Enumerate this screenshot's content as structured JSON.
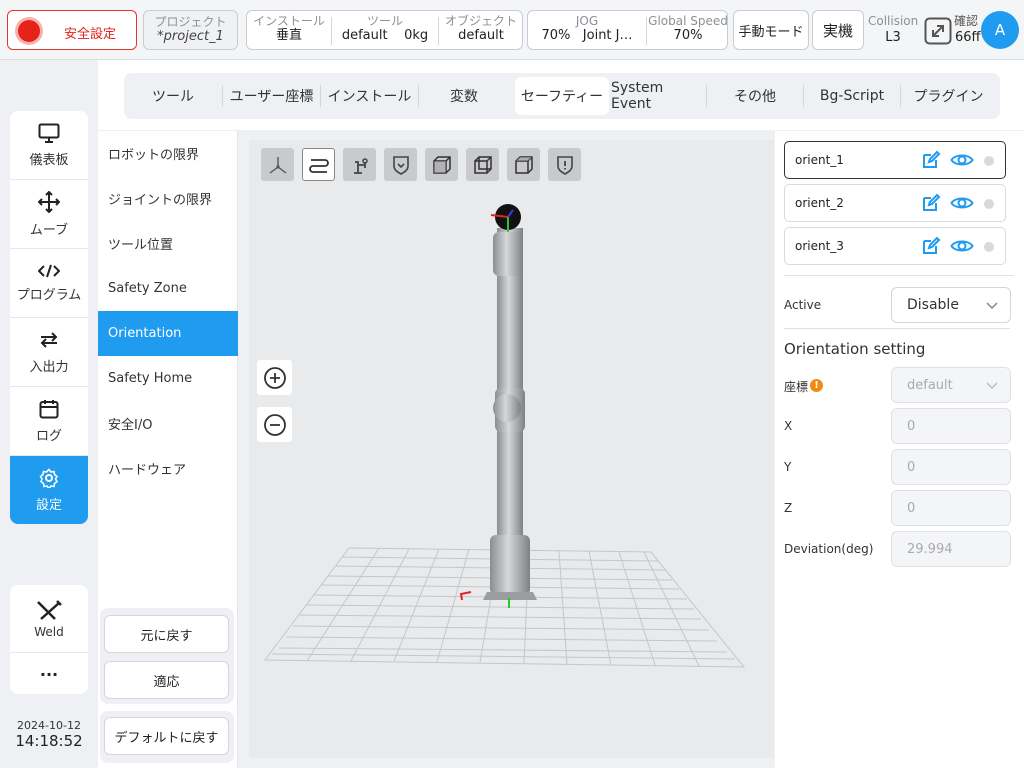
{
  "topbar": {
    "safety_label": "安全設定",
    "project": {
      "label": "プロジェクト",
      "value": "*project_1"
    },
    "install": {
      "label": "インストール",
      "value": "垂直"
    },
    "tool": {
      "label": "ツール",
      "value": "default",
      "payload": "0kg"
    },
    "object": {
      "label": "オブジェクト",
      "value": "default"
    },
    "jog": {
      "label": "JOG",
      "percent": "70%",
      "mode": "Joint J…"
    },
    "global_speed": {
      "label": "Global Speed",
      "value": "70%"
    },
    "manual_mode": "手動モード",
    "real": "実機",
    "collision": {
      "label": "Collision",
      "value": "L3"
    },
    "confirm": {
      "label": "確認",
      "value": "66ff"
    },
    "avatar": "A"
  },
  "nav": {
    "items": [
      {
        "label": "儀表板",
        "icon": "monitor-icon"
      },
      {
        "label": "ムーブ",
        "icon": "move-icon"
      },
      {
        "label": "プログラム",
        "icon": "code-icon"
      },
      {
        "label": "入出力",
        "icon": "io-icon"
      },
      {
        "label": "ログ",
        "icon": "calendar-icon"
      },
      {
        "label": "設定",
        "icon": "gear-icon"
      }
    ],
    "weld": "Weld",
    "more": "···",
    "date": "2024-10-12",
    "time": "14:18:52"
  },
  "tabs": [
    "ツール",
    "ユーザー座標",
    "インストール",
    "変数",
    "セーフティー",
    "System Event",
    "その他",
    "Bg-Script",
    "プラグイン"
  ],
  "active_tab": "セーフティー",
  "submenu": {
    "items": [
      "ロボットの限界",
      "ジョイントの限界",
      "ツール位置",
      "Safety Zone",
      "Orientation",
      "Safety Home",
      "安全I/O",
      "ハードウェア"
    ],
    "active": "Orientation",
    "revert": "元に戻す",
    "apply": "適応",
    "reset_default": "デフォルトに戻す"
  },
  "orientations": [
    {
      "name": "orient_1",
      "selected": true
    },
    {
      "name": "orient_2",
      "selected": false
    },
    {
      "name": "orient_3",
      "selected": false
    }
  ],
  "form": {
    "active_label": "Active",
    "active_value": "Disable",
    "section_title": "Orientation setting",
    "coord_label": "座標",
    "coord_value": "default",
    "x_label": "X",
    "x_value": "0",
    "y_label": "Y",
    "y_value": "0",
    "z_label": "Z",
    "z_value": "0",
    "deviation_label": "Deviation(deg)",
    "deviation_value": "29.994"
  },
  "colors": {
    "accent": "#1f9bf0",
    "danger": "#e2231b"
  }
}
